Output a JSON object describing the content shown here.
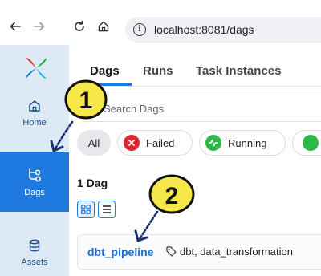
{
  "browser": {
    "url": "localhost:8081/dags"
  },
  "sidebar": {
    "items": [
      {
        "label": "Home",
        "icon": "home-icon"
      },
      {
        "label": "Dags",
        "icon": "dags-icon",
        "active": true
      },
      {
        "label": "Assets",
        "icon": "assets-icon"
      }
    ]
  },
  "tabs": [
    {
      "label": "Dags",
      "active": true
    },
    {
      "label": "Runs"
    },
    {
      "label": "Task Instances"
    }
  ],
  "search": {
    "placeholder": "Search Dags"
  },
  "filters": [
    {
      "label": "All",
      "selected": true
    },
    {
      "label": "Failed",
      "icon": "failed-icon",
      "color": "#e0282e"
    },
    {
      "label": "Running",
      "icon": "running-icon",
      "color": "#2eb84a"
    }
  ],
  "summary": {
    "count_label": "1 Dag"
  },
  "dags": [
    {
      "name": "dbt_pipeline",
      "tags": "dbt, data_transformation"
    }
  ],
  "annotations": [
    {
      "label": "1"
    },
    {
      "label": "2"
    }
  ],
  "colors": {
    "accent": "#1e7ae0",
    "sidebar_bg": "#dde9f5",
    "annotation": "#f7e84a"
  }
}
